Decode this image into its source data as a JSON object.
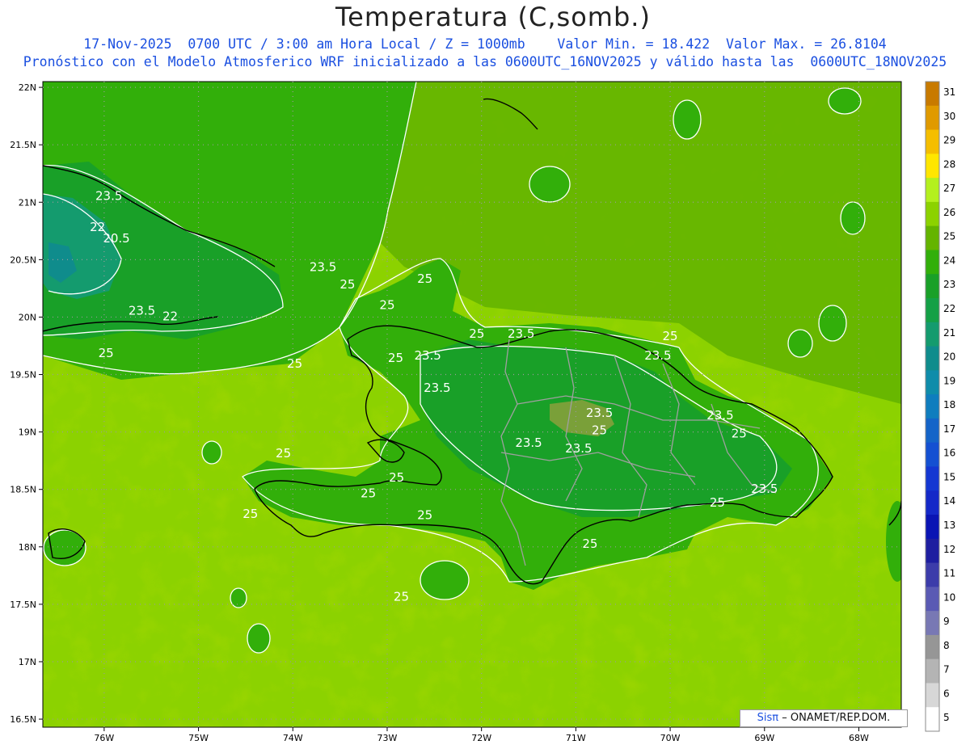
{
  "title": "Temperatura (C,somb.)",
  "subtitle_line1": "17-Nov-2025  0700 UTC / 3:00 am Hora Local / Z = 1000mb    Valor Min. = 18.422  Valor Max. = 26.8104",
  "subtitle_line2": "Pronóstico con el Modelo Atmosferico WRF inicializado a las 0600UTC_16NOV2025 y válido hasta las  0600UTC_18NOV2025",
  "credit": {
    "brand": "Sisπ",
    "text": "– ONAMET/REP.DOM."
  },
  "lat_labels": [
    "22N",
    "21.5N",
    "21N",
    "20.5N",
    "20N",
    "19.5N",
    "19N",
    "18.5N",
    "18N",
    "17.5N",
    "17N",
    "16.5N"
  ],
  "lon_labels": [
    "76W",
    "75W",
    "74W",
    "73W",
    "72W",
    "71W",
    "70W",
    "69W",
    "68W"
  ],
  "colorbar": {
    "levels": [
      "31",
      "30",
      "29",
      "28",
      "27",
      "26",
      "25",
      "24",
      "23",
      "22",
      "21",
      "20",
      "19",
      "18",
      "17",
      "16",
      "15",
      "14",
      "13",
      "12",
      "11",
      "10",
      "9",
      "8",
      "7",
      "6",
      "5"
    ],
    "colors": [
      "#c87a00",
      "#e09a00",
      "#f5be00",
      "#ffe600",
      "#b4f01e",
      "#8cd200",
      "#64b400",
      "#32af0a",
      "#19a028",
      "#14a046",
      "#149b6e",
      "#0f8c8c",
      "#0f8caa",
      "#0f7dbe",
      "#1464c8",
      "#1450d2",
      "#1437d2",
      "#1428c8",
      "#0a14b4",
      "#1e1ea0",
      "#3c3caa",
      "#5a5ab4",
      "#7878b4",
      "#969696",
      "#b4b4b4",
      "#d7d7d7",
      "#ffffff"
    ]
  },
  "contour_labels": [
    {
      "text": "23.5",
      "lon": -75.95,
      "lat": 21.02
    },
    {
      "text": "22",
      "lon": -76.07,
      "lat": 20.75
    },
    {
      "text": "20.5",
      "lon": -75.87,
      "lat": 20.65
    },
    {
      "text": "23.5",
      "lon": -73.68,
      "lat": 20.4
    },
    {
      "text": "25",
      "lon": -73.42,
      "lat": 20.25
    },
    {
      "text": "25",
      "lon": -73.0,
      "lat": 20.07
    },
    {
      "text": "23.5",
      "lon": -75.6,
      "lat": 20.02
    },
    {
      "text": "22",
      "lon": -75.3,
      "lat": 19.97
    },
    {
      "text": "25",
      "lon": -75.98,
      "lat": 19.65
    },
    {
      "text": "25",
      "lon": -73.98,
      "lat": 19.56
    },
    {
      "text": "25",
      "lon": -72.6,
      "lat": 20.3
    },
    {
      "text": "25",
      "lon": -72.05,
      "lat": 19.82
    },
    {
      "text": "23.5",
      "lon": -71.58,
      "lat": 19.82
    },
    {
      "text": "25",
      "lon": -72.91,
      "lat": 19.61
    },
    {
      "text": "23.5",
      "lon": -72.57,
      "lat": 19.63
    },
    {
      "text": "23.5",
      "lon": -72.47,
      "lat": 19.35
    },
    {
      "text": "25",
      "lon": -70.0,
      "lat": 19.8
    },
    {
      "text": "23.5",
      "lon": -70.13,
      "lat": 19.63
    },
    {
      "text": "23.5",
      "lon": -70.75,
      "lat": 19.13
    },
    {
      "text": "25",
      "lon": -70.75,
      "lat": 18.98
    },
    {
      "text": "23.5",
      "lon": -71.5,
      "lat": 18.87
    },
    {
      "text": "23.5",
      "lon": -70.97,
      "lat": 18.82
    },
    {
      "text": "23.5",
      "lon": -69.47,
      "lat": 19.11
    },
    {
      "text": "25",
      "lon": -69.27,
      "lat": 18.95
    },
    {
      "text": "23.5",
      "lon": -69.0,
      "lat": 18.47
    },
    {
      "text": "25",
      "lon": -69.5,
      "lat": 18.35
    },
    {
      "text": "25",
      "lon": -74.1,
      "lat": 18.78
    },
    {
      "text": "25",
      "lon": -72.9,
      "lat": 18.57
    },
    {
      "text": "25",
      "lon": -73.2,
      "lat": 18.43
    },
    {
      "text": "25",
      "lon": -72.6,
      "lat": 18.24
    },
    {
      "text": "25",
      "lon": -74.45,
      "lat": 18.25
    },
    {
      "text": "25",
      "lon": -70.85,
      "lat": 17.99
    },
    {
      "text": "25",
      "lon": -72.85,
      "lat": 17.53
    }
  ]
}
